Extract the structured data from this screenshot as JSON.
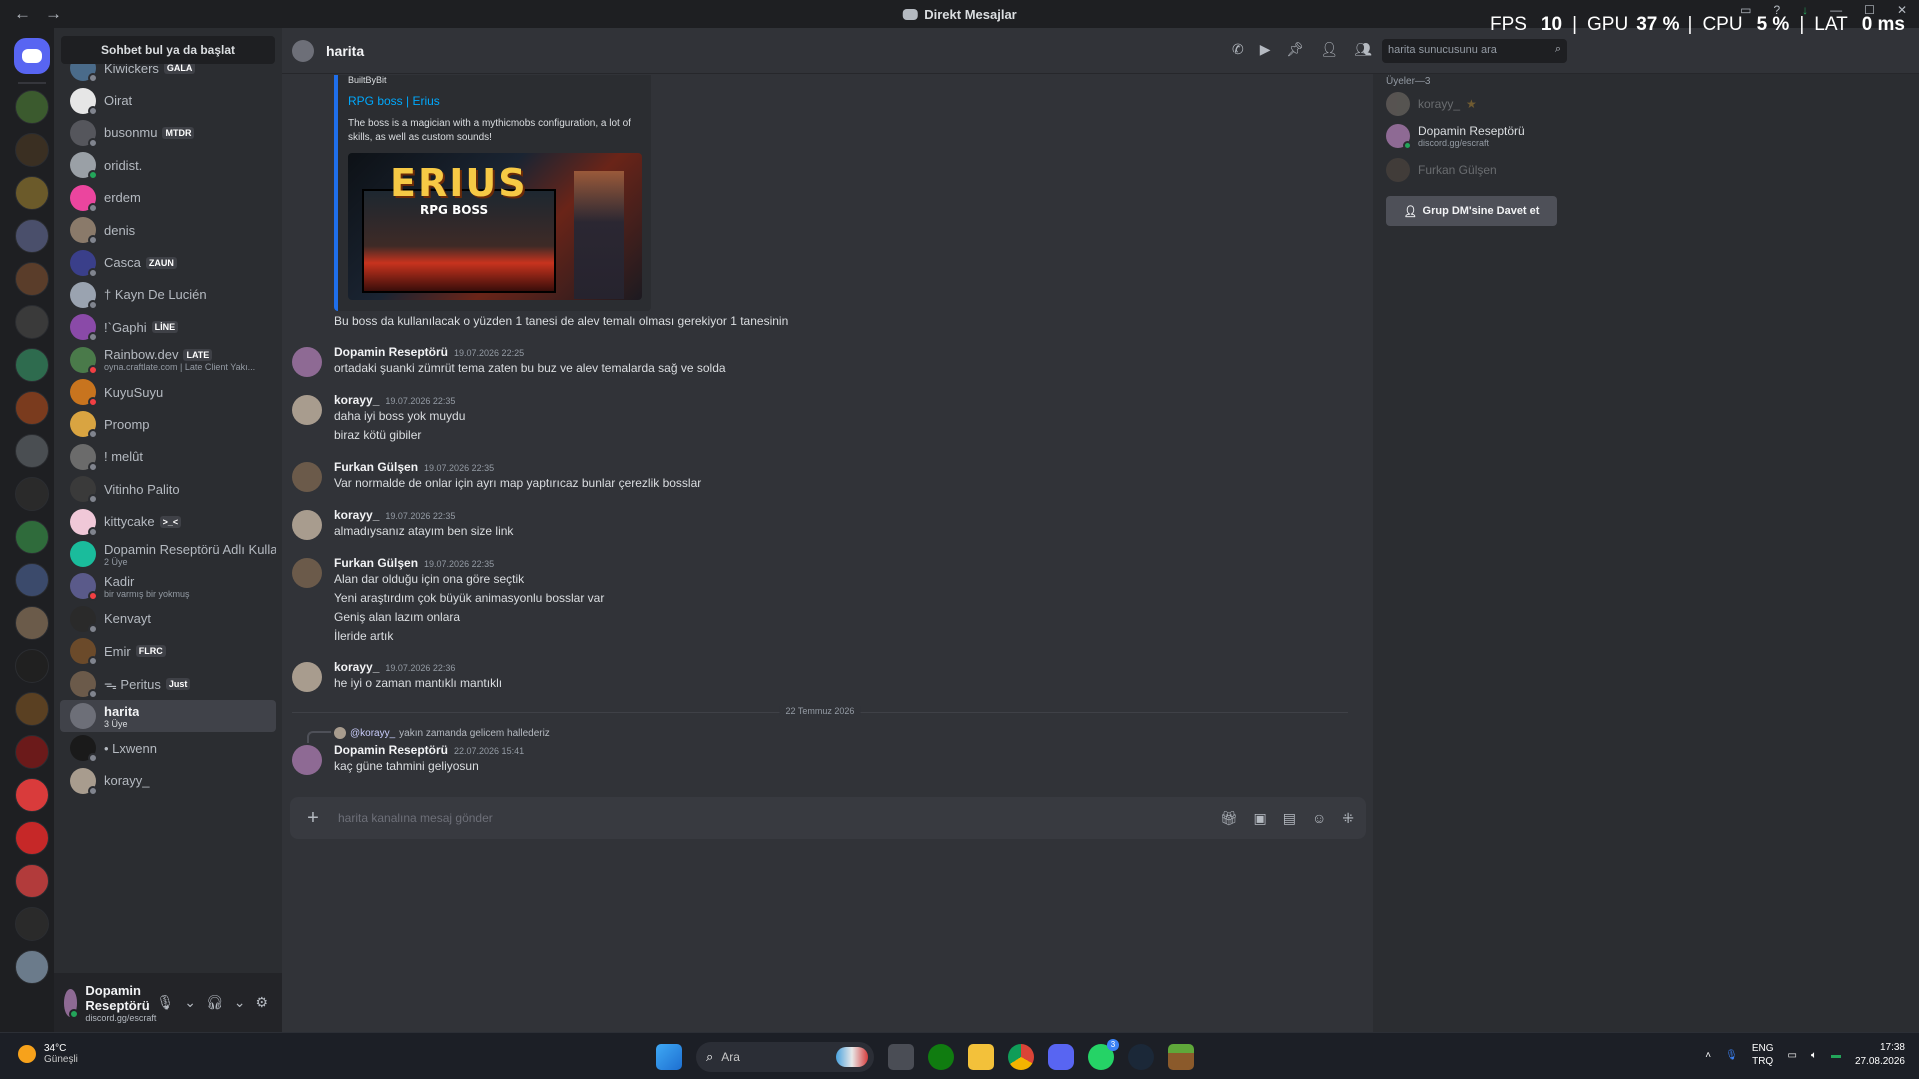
{
  "window": {
    "title": "Direkt Mesajlar",
    "back_glyph": "←",
    "forward_glyph": "→"
  },
  "perf_overlay": {
    "fps_label": "FPS",
    "fps_value": "10",
    "gpu_label": "GPU",
    "gpu_value": "37 %",
    "cpu_label": "CPU",
    "cpu_value": "5 %",
    "lat_label": "LAT",
    "lat_value": "0 ms"
  },
  "servers": {
    "colors": [
      "#3b5a2e",
      "#3a2f22",
      "#6b5a2a",
      "#4a4f6b",
      "#5a3d2a",
      "#3a3a3a",
      "#2e6b4e",
      "#7a3b1e",
      "#4a4e52",
      "#2a2a2a",
      "#2f6b3b",
      "#3b4a6b",
      "#6b5b4a",
      "#202020",
      "#5a4022",
      "#6b1a1a",
      "#d93b3b",
      "#c62828",
      "#b23b3b",
      "#2a2a2a",
      "#6b7b8b"
    ]
  },
  "dm_sidebar": {
    "search_label": "Sohbet bul ya da başlat",
    "items": [
      {
        "name": "Kiwickers",
        "tag": "GALA",
        "sub": "",
        "color": "#4a6b8a",
        "status": "#80848e"
      },
      {
        "name": "Oirat",
        "tag": "",
        "sub": "",
        "color": "#e6e6e6",
        "status": "#80848e"
      },
      {
        "name": "busonmu",
        "tag": "MTDR",
        "sub": "",
        "color": "#55565c",
        "status": "#80848e"
      },
      {
        "name": "oridist.",
        "tag": "",
        "sub": "",
        "color": "#9aa0a6",
        "status": "#23a55a"
      },
      {
        "name": "erdem",
        "tag": "",
        "sub": "",
        "color": "#eb459e",
        "status": "#80848e"
      },
      {
        "name": "denis",
        "tag": "",
        "sub": "",
        "color": "#8a7a6a",
        "status": "#80848e"
      },
      {
        "name": "Casca",
        "tag": "ZAUN",
        "sub": "",
        "color": "#3a3f8a",
        "status": "#80848e"
      },
      {
        "name": "† Kayn De Lucién",
        "tag": "",
        "sub": "",
        "color": "#9aa3b0",
        "status": "#80848e"
      },
      {
        "name": "!`Gaphi",
        "tag": "LİNE",
        "sub": "",
        "color": "#8a4aa8",
        "status": "#80848e"
      },
      {
        "name": "Rainbow.dev",
        "tag": "LATE",
        "sub": "oyna.craftlate.com | Late Client Yakı...",
        "color": "#4a7a4a",
        "status": "#f23f43"
      },
      {
        "name": "KuyuSuyu",
        "tag": "",
        "sub": "",
        "color": "#c8741e",
        "status": "#f23f43"
      },
      {
        "name": "Proomp",
        "tag": "",
        "sub": "",
        "color": "#d9a441",
        "status": "#80848e"
      },
      {
        "name": "! melût",
        "tag": "",
        "sub": "",
        "color": "#6b6b6b",
        "status": "#80848e"
      },
      {
        "name": "Vitinho Palito",
        "tag": "",
        "sub": "",
        "color": "#3a3a3a",
        "status": "#80848e"
      },
      {
        "name": "kittycake",
        "tag": ">_<",
        "sub": "",
        "color": "#f0c8d8",
        "status": "#80848e"
      },
      {
        "name": "Dopamin Reseptörü Adlı Kullanı...",
        "tag": "",
        "sub": "2 Üye",
        "color": "#1abc9c",
        "status": ""
      },
      {
        "name": "Kadir",
        "tag": "",
        "sub": "bir varmış bir yokmuş",
        "color": "#5a5a8a",
        "status": "#f23f43"
      },
      {
        "name": "Kenvayt",
        "tag": "",
        "sub": "",
        "color": "#2a2a2a",
        "status": "#80848e"
      },
      {
        "name": "Emir",
        "tag": "FLRC",
        "sub": "",
        "color": "#6b4a2a",
        "status": "#80848e"
      },
      {
        "name": "ᯓ Peritus",
        "tag": "Just",
        "sub": "",
        "color": "#6b5a4a",
        "status": "#80848e"
      },
      {
        "name": "harita",
        "tag": "",
        "sub": "3 Üye",
        "color": "#6d6f78",
        "status": "",
        "active": true
      },
      {
        "name": "• Lxwenn",
        "tag": "",
        "sub": "",
        "color": "#1a1a1a",
        "status": "#80848e"
      },
      {
        "name": "korayy_",
        "tag": "",
        "sub": "",
        "color": "#a89c8e",
        "status": "#80848e"
      }
    ]
  },
  "user_panel": {
    "name": "Dopamin Reseptörü",
    "status": "discord.gg/escraft",
    "controls": [
      "mic-icon",
      "chevron",
      "headset-icon",
      "chevron",
      "gear-icon"
    ]
  },
  "chat_header": {
    "title": "harita",
    "search_placeholder": "harita sunucusunu ara"
  },
  "embed": {
    "provider": "BuiltByBit",
    "title": "RPG boss | Erius",
    "description": "The boss is a magician with a mythicmobs configuration, a lot of skills, as well as custom sounds!",
    "image_logo": "ERIUS",
    "image_sub": "RPG BOSS"
  },
  "messages": {
    "m0_line": "Bu boss da kullanılacak o yüzden 1 tanesi de alev temalı olması gerekiyor 1 tanesinin",
    "m1": {
      "author": "Dopamin Reseptörü",
      "time": "19.07.2026 22:25",
      "lines": [
        "ortadaki şuanki zümrüt tema zaten bu buz ve alev temalarda sağ ve solda"
      ]
    },
    "m2": {
      "author": "korayy_",
      "time": "19.07.2026 22:35",
      "lines": [
        "daha iyi boss yok muydu",
        "biraz kötü gibiler"
      ]
    },
    "m3": {
      "author": "Furkan Gülşen",
      "time": "19.07.2026 22:35",
      "lines": [
        "Var normalde de onlar için ayrı map yaptırıcaz bunlar çerezlik bosslar"
      ]
    },
    "m4": {
      "author": "korayy_",
      "time": "19.07.2026 22:35",
      "lines": [
        "almadıysanız atayım ben size link"
      ]
    },
    "m5": {
      "author": "Furkan Gülşen",
      "time": "19.07.2026 22:35",
      "lines": [
        "Alan dar olduğu için ona göre seçtik",
        "Yeni araştırdım çok büyük animasyonlu bosslar var",
        "Geniş alan lazım onlara",
        "İleride artık"
      ]
    },
    "m6": {
      "author": "korayy_",
      "time": "19.07.2026 22:36",
      "lines": [
        "he iyi o zaman mantıklı mantıklı"
      ]
    },
    "date_divider": "22 Temmuz 2026",
    "reply": {
      "mention": "@korayy_",
      "text": "yakın zamanda gelicem hallederiz"
    },
    "m7": {
      "author": "Dopamin Reseptörü",
      "time": "22.07.2026 15:41",
      "lines": [
        "kaç güne tahmini geliyosun"
      ]
    }
  },
  "composer": {
    "placeholder": "harita kanalına mesaj gönder"
  },
  "members": {
    "header": "Üyeler—3",
    "list": [
      {
        "name": "korayy_",
        "sub": "",
        "offline": true,
        "color": "#a89c8e",
        "owner_glyph": "★"
      },
      {
        "name": "Dopamin Reseptörü",
        "sub": "discord.gg/escraft",
        "offline": false,
        "color": "#8e6a94"
      },
      {
        "name": "Furkan Gülşen",
        "sub": "",
        "offline": true,
        "color": "#6b5a4a"
      }
    ],
    "invite_label": "Grup DM'sine Davet et"
  },
  "taskbar": {
    "temp": "34°C",
    "weather": "Güneşli",
    "search_label": "Ara",
    "whatsapp_badge": "3",
    "lang_top": "ENG",
    "lang_bottom": "TRQ",
    "time": "17:38",
    "date": "27.08.2026"
  }
}
